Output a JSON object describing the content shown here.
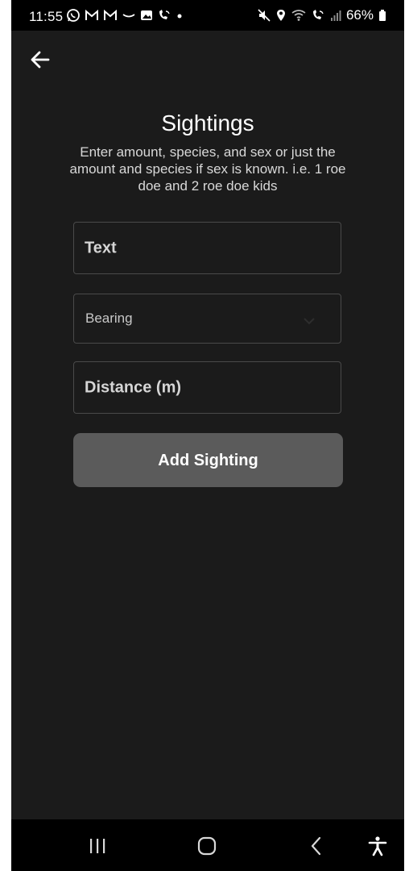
{
  "status_bar": {
    "time": "11:55",
    "battery": "66%",
    "left_icons": [
      "whatsapp-icon",
      "gmail-icon",
      "gmail-icon",
      "smile-icon",
      "gallery-icon",
      "wifi-call-icon",
      "dot-icon"
    ],
    "right_icons": [
      "mute-icon",
      "location-icon",
      "wifi-icon",
      "wifi-call-icon",
      "signal-icon",
      "battery-icon"
    ]
  },
  "header": {
    "back_icon": "arrow-left-icon"
  },
  "main": {
    "title": "Sightings",
    "description": "Enter amount, species, and sex or just the amount and species if sex is known. i.e. 1 roe doe and 2 roe doe kids"
  },
  "form": {
    "text_placeholder": "Text",
    "bearing_placeholder": "Bearing",
    "distance_placeholder": "Distance (m)",
    "add_button_label": "Add Sighting"
  },
  "nav_bar": {
    "recents_icon": "recents-icon",
    "home_icon": "home-icon",
    "back_icon": "back-chevron-icon",
    "accessibility_icon": "accessibility-icon"
  },
  "colors": {
    "background": "#1b1b1b",
    "button": "#5b5b5b",
    "field_border": "#4a4a4a",
    "text": "#ffffff"
  }
}
